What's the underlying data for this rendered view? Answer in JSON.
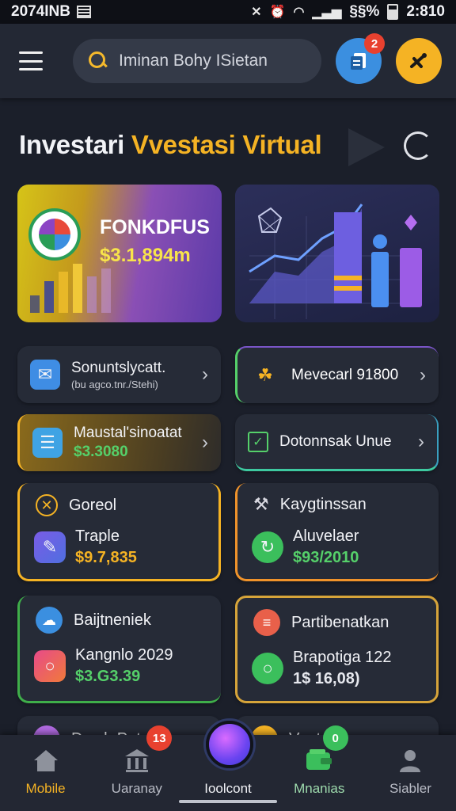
{
  "status_bar": {
    "left_text": "2074INB",
    "time": "2:810",
    "right_text": "§§%"
  },
  "header": {
    "search_placeholder": "Iminan Bohy ISietan",
    "notification_count": "2",
    "colors": {
      "doc_button": "#3b8fe0",
      "profile_button": "#f5b324"
    }
  },
  "section": {
    "title_part1": "Investari",
    "title_part2": "Vvestasi Virtual"
  },
  "feature_card": {
    "name": "FONKDFUS",
    "value": "$3.1,894m"
  },
  "list_cards": [
    {
      "title": "Sonuntslycatt.",
      "subtitle": "(bu agco.tnr./Stehi)"
    },
    {
      "title": "Mevecarl 91800"
    },
    {
      "title": "Maustal'sinoatat",
      "value": "$3.3080"
    },
    {
      "title": "Dotonnsak Unue"
    }
  ],
  "big_cards": [
    {
      "header": "Goreol",
      "item": "Traple",
      "value": "$9.7,835"
    },
    {
      "header": "Kaygtinssan",
      "item": "Aluvelaer",
      "value": "$93/2010"
    },
    {
      "header": "Baijtneniek",
      "item": "Kangnlo 2029",
      "value": "$3.G3.39"
    },
    {
      "header": "Partibenatkan",
      "item": "Brapotiga 122",
      "value": "1$ 16,08)"
    }
  ],
  "partial_cards": {
    "left": "Dmyh Patan",
    "right": "Vootat"
  },
  "bottom_nav": {
    "items": [
      "Mobile",
      "Uaranay",
      "Ioolcont",
      "Mnanias",
      "Siabler"
    ],
    "badge_uaranay": "13",
    "badge_mnanias": "0",
    "active_color": "#f5b324"
  },
  "colors": {
    "background": "#1b1f2a",
    "accent": "#f5b324",
    "positive": "#55d06a"
  }
}
